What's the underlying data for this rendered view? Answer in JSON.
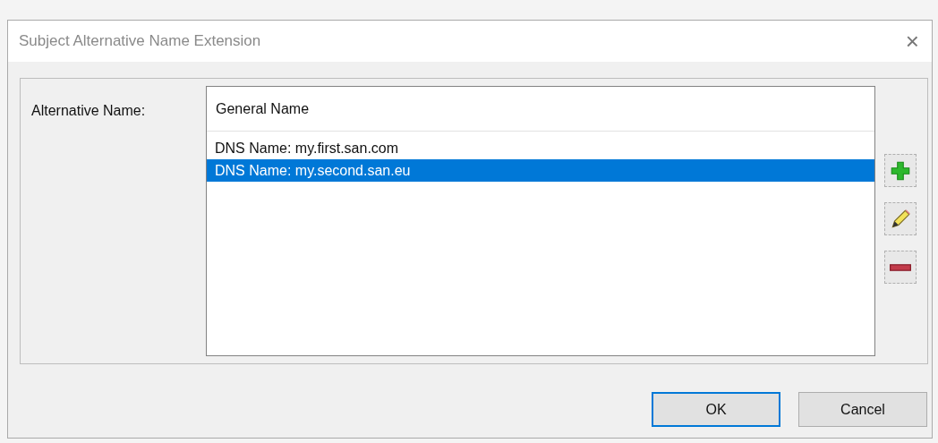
{
  "window": {
    "title": "Subject Alternative Name Extension",
    "close": "×"
  },
  "label": "Alternative Name:",
  "list": {
    "columns": [
      "General Name"
    ],
    "rows": [
      {
        "text": "DNS Name: my.first.san.com",
        "selected": false
      },
      {
        "text": "DNS Name: my.second.san.eu",
        "selected": true
      }
    ]
  },
  "side_buttons": [
    {
      "kind": "add"
    },
    {
      "kind": "edit"
    },
    {
      "kind": "remove"
    }
  ],
  "buttons": [
    {
      "label": "OK",
      "default": true
    },
    {
      "label": "Cancel",
      "default": false
    }
  ]
}
